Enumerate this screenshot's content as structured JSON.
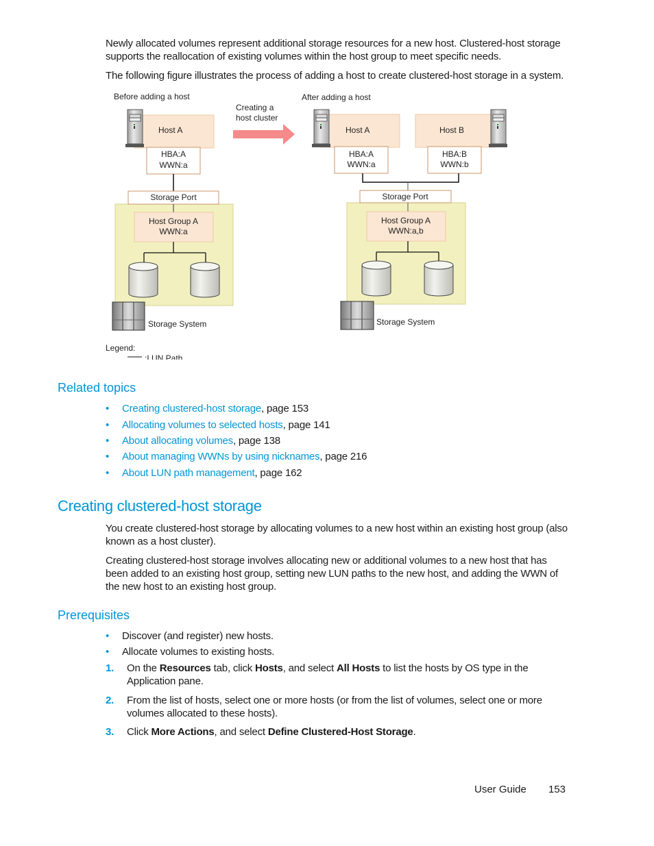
{
  "intro": {
    "para1": "Newly allocated volumes represent additional storage resources for a new host. Clustered-host storage supports the reallocation of existing volumes within the host group to meet specific needs.",
    "para2": "The following figure illustrates the process of adding a host to create clustered-host storage in a system."
  },
  "figure": {
    "before_label": "Before adding a host",
    "after_label": "After adding a host",
    "arrow_label_line1": "Creating a",
    "arrow_label_line2": "host cluster",
    "arrow_color": "#f48a8a",
    "host_fill": "#fbe6d3",
    "storage_fill": "#f2f0bf",
    "box_border": "#c8956a",
    "before": {
      "host": "Host A",
      "hba_line1": "HBA:A",
      "hba_line2": "WWN:a",
      "port": "Storage Port",
      "group_line1": "Host Group A",
      "group_line2": "WWN:a",
      "system": "Storage System"
    },
    "after": {
      "host_a": "Host A",
      "host_b": "Host B",
      "hba_a_line1": "HBA:A",
      "hba_a_line2": "WWN:a",
      "hba_b_line1": "HBA:B",
      "hba_b_line2": "WWN:b",
      "port": "Storage Port",
      "group_line1": "Host Group A",
      "group_line2": "WWN:a,b",
      "system": "Storage System"
    },
    "legend_title": "Legend:",
    "legend_item": ":LUN Path"
  },
  "related": {
    "heading": "Related topics",
    "items": [
      {
        "link": "Creating clustered-host storage",
        "suffix": ", page 153"
      },
      {
        "link": "Allocating volumes to selected hosts",
        "suffix": ", page 141"
      },
      {
        "link": "About allocating volumes",
        "suffix": ", page 138"
      },
      {
        "link": "About managing WWNs by using nicknames",
        "suffix": ", page 216"
      },
      {
        "link": "About LUN path management",
        "suffix": ", page 162"
      }
    ]
  },
  "section": {
    "title": "Creating clustered-host storage",
    "para1": "You create clustered-host storage by allocating volumes to a new host within an existing host group (also known as a host cluster).",
    "para2": "Creating clustered-host storage involves allocating new or additional volumes to a new host that has been added to an existing host group, setting new LUN paths to the new host, and adding the WWN of the new host to an existing host group."
  },
  "prereq": {
    "heading": "Prerequisites",
    "bullets": [
      "Discover (and register) new hosts.",
      "Allocate volumes to existing hosts."
    ],
    "steps": [
      {
        "num": "1.",
        "t1": "On the ",
        "b1": "Resources",
        "t2": " tab, click ",
        "b2": "Hosts",
        "t3": ", and select ",
        "b3": "All Hosts",
        "t4": " to list the hosts by OS type in the Application pane."
      },
      {
        "num": "2.",
        "t1": "From the list of hosts, select one or more hosts (or from the list of volumes, select one or more volumes allocated to these hosts)."
      },
      {
        "num": "3.",
        "t1": "Click ",
        "b1": "More Actions",
        "t2": ", and select ",
        "b2": "Define Clustered-Host Storage",
        "t3": "."
      }
    ]
  },
  "footer": {
    "guide": "User Guide",
    "page": "153"
  }
}
